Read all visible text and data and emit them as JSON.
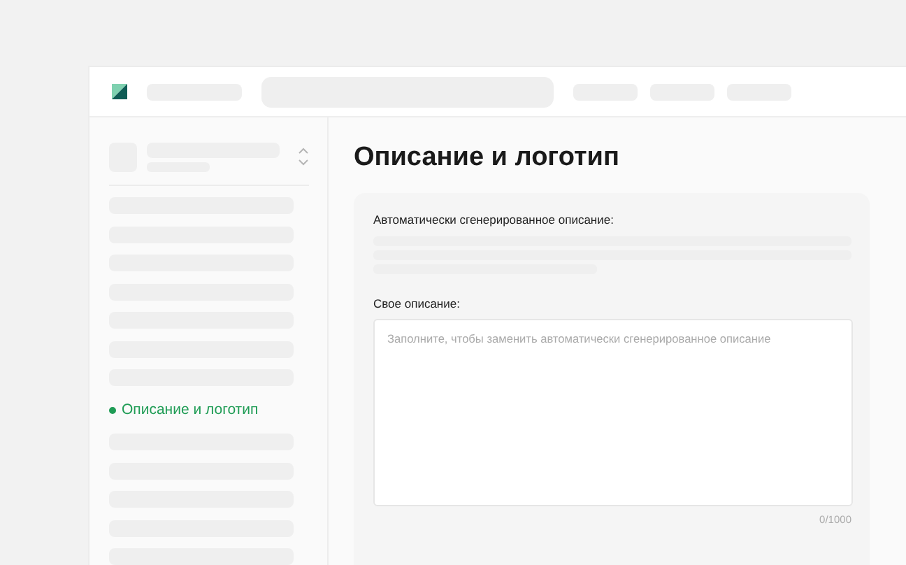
{
  "sidebar": {
    "items": [
      {
        "kind": "skeleton"
      },
      {
        "kind": "skeleton"
      },
      {
        "kind": "skeleton"
      },
      {
        "kind": "skeleton"
      },
      {
        "kind": "skeleton"
      },
      {
        "kind": "skeleton"
      },
      {
        "kind": "skeleton"
      },
      {
        "kind": "link",
        "label": "Описание и логотип",
        "selected": true
      },
      {
        "kind": "skeleton"
      },
      {
        "kind": "skeleton"
      },
      {
        "kind": "skeleton"
      },
      {
        "kind": "skeleton"
      },
      {
        "kind": "skeleton"
      }
    ]
  },
  "page": {
    "title": "Описание и логотип",
    "auto_label": "Автоматически сгенерированное описание:",
    "custom_label": "Свое описание:",
    "custom_field": {
      "placeholder": "Заполните, чтобы заменить автоматически сгенерированное описание"
    },
    "counter": "0/1000"
  }
}
